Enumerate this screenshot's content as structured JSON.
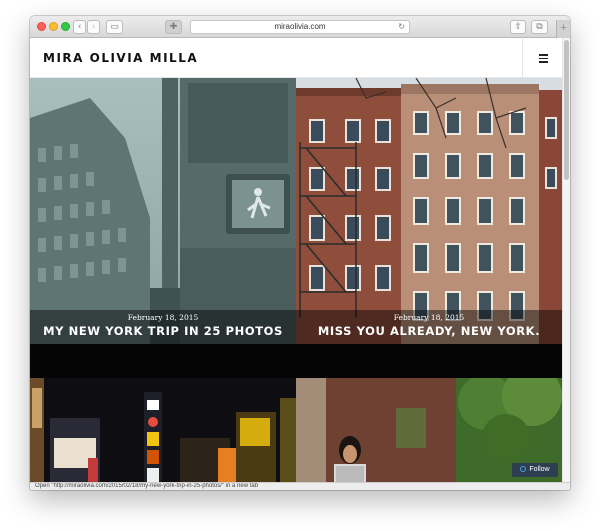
{
  "browser": {
    "address": "miraolivia.com",
    "tab_add": "+"
  },
  "site": {
    "title": "MIRA OLIVIA MILLA"
  },
  "posts": [
    {
      "date": "February 18, 2015",
      "title": "MY NEW YORK TRIP IN 25 PHOTOS"
    },
    {
      "date": "February 18, 2015",
      "title": "MISS YOU ALREADY, NEW YORK."
    }
  ],
  "follow": {
    "label": "Follow"
  },
  "status": {
    "text": "Open \"http://miraolivia.com/2015/02/18/my-new-york-trip-in-25-photos/\" in a new tab"
  }
}
